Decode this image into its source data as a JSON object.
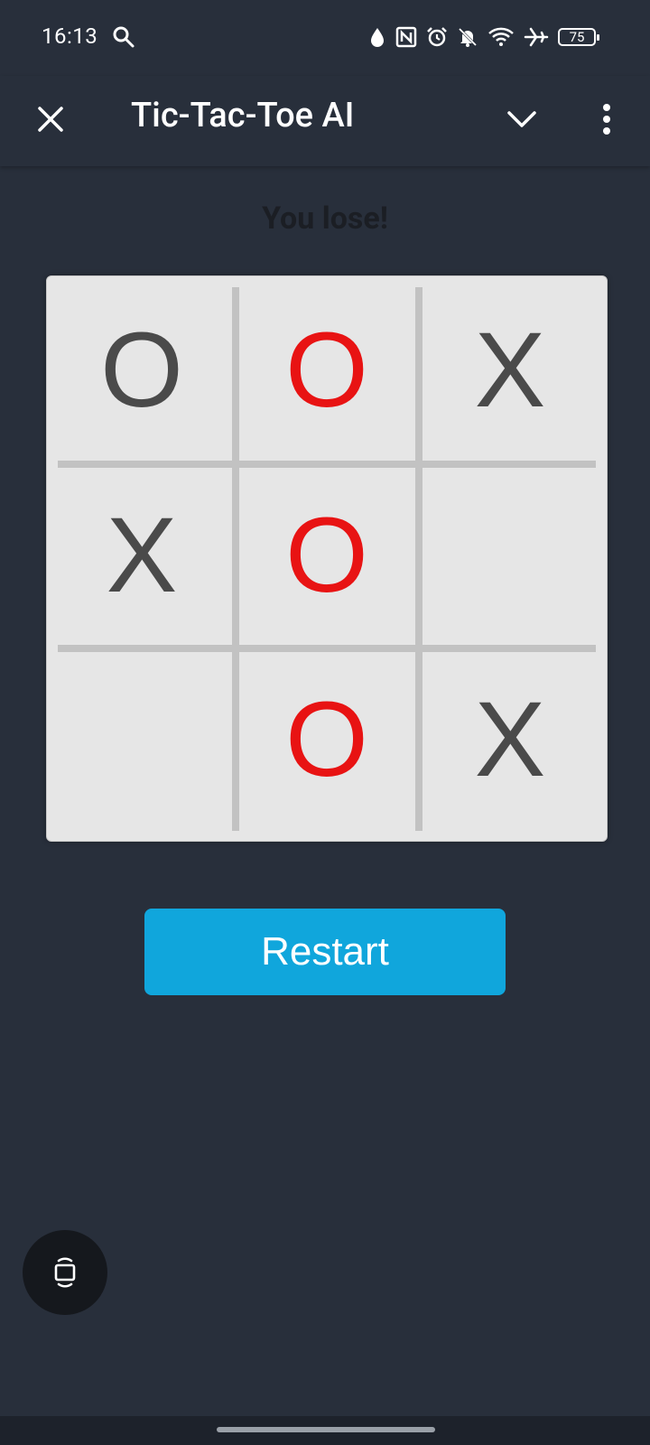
{
  "status_bar": {
    "time": "16:13",
    "battery_level": "75",
    "icons": [
      "search-icon",
      "data-saver-icon",
      "nfc-icon",
      "alarm-icon",
      "notifications-off-icon",
      "wifi-icon",
      "airplane-mode-icon",
      "battery-icon"
    ]
  },
  "app_bar": {
    "title": "Tic-Tac-Toe AI",
    "icons": [
      "close-icon",
      "chevron-down-icon",
      "more-vert-icon"
    ]
  },
  "game": {
    "status_text": "You lose!",
    "board": [
      [
        "O",
        "O",
        "X"
      ],
      [
        "X",
        "O",
        ""
      ],
      [
        "",
        "O",
        "X"
      ]
    ],
    "winning_line": "column-2",
    "mark_color": "#4a4a4a",
    "win_color": "#e81313"
  },
  "restart_label": "Restart",
  "floating_button_icon": "screen-rotate-icon",
  "colors": {
    "background": "#282f3b",
    "board": "#e6e6e6",
    "button": "#10a6dc"
  }
}
